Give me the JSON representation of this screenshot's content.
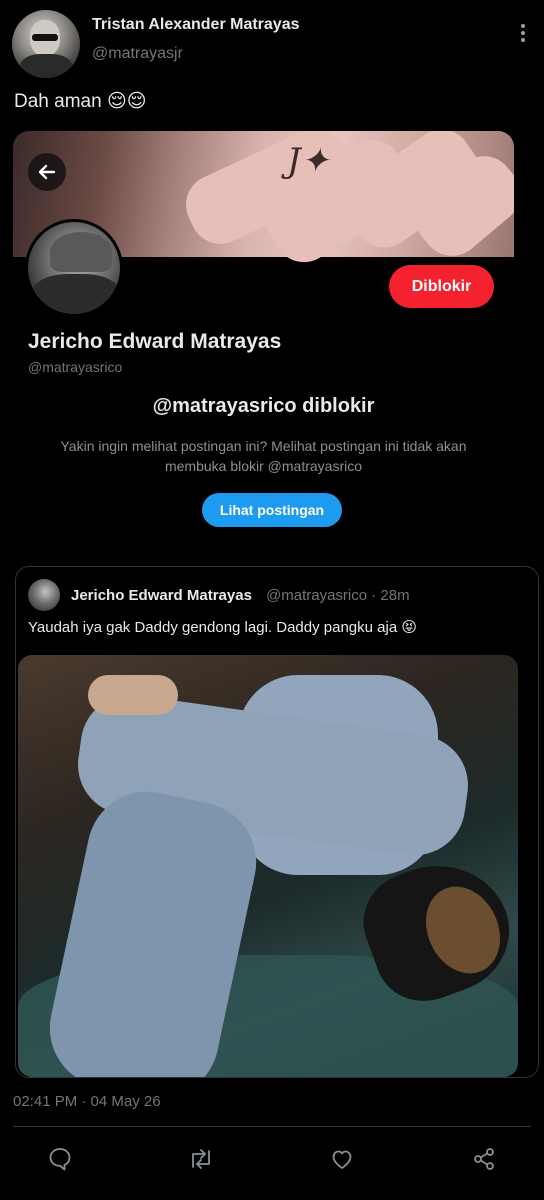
{
  "tweet": {
    "author_name": "Tristan Alexander Matrayas",
    "author_handle": "@matrayasjr",
    "text": "Dah aman 😌😌",
    "timestamp": "02:41 PM · 04 May 26"
  },
  "blocked_card": {
    "button_label": "Diblokir",
    "name": "Jericho Edward Matrayas",
    "handle": "@matrayasrico",
    "title": "@matrayasrico diblokir",
    "description": "Yakin ingin melihat postingan ini? Melihat postingan ini tidak akan membuka blokir @matrayasrico",
    "view_button_label": "Lihat postingan"
  },
  "quoted_tweet": {
    "author_name": "Jericho Edward Matrayas",
    "meta": "@matrayasrico · 28m",
    "text": "Yaudah iya gak Daddy gendong lagi. Daddy pangku aja 😝"
  },
  "icons": {
    "more": "more-vertical-icon",
    "back": "arrow-left-icon",
    "reply": "reply-icon",
    "retweet": "retweet-icon",
    "like": "heart-icon",
    "share": "share-icon"
  },
  "colors": {
    "background": "#000000",
    "blocked_button": "#f4212e",
    "view_button": "#1d9bf0",
    "secondary_text": "#71767b"
  }
}
